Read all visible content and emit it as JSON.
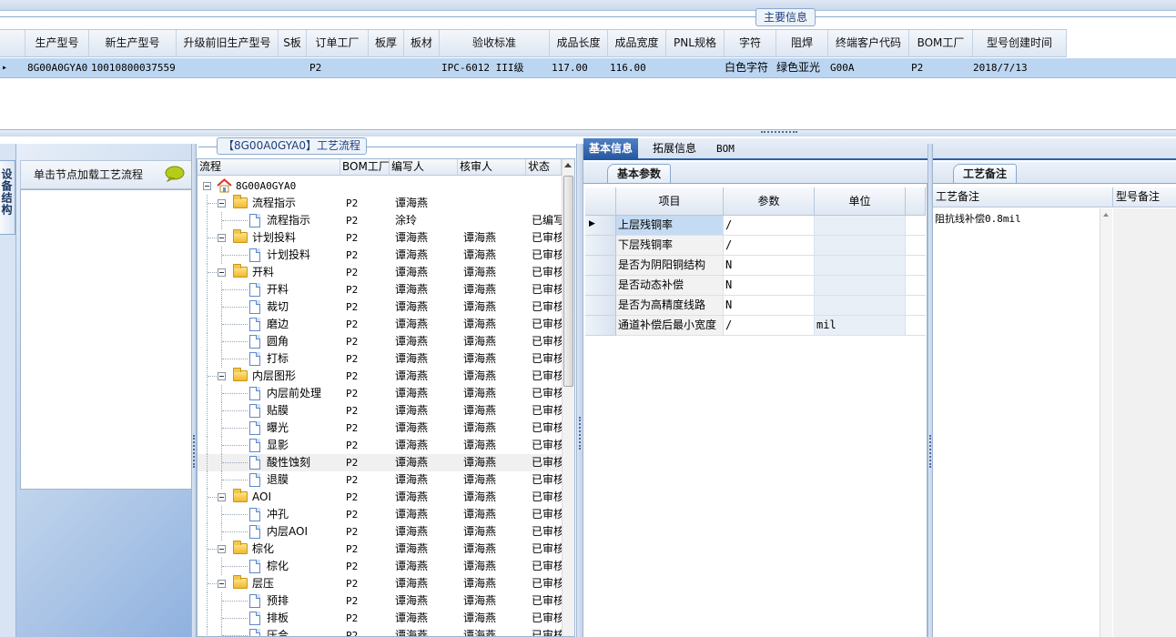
{
  "top": {
    "section_label": "主要信息",
    "columns": [
      "生产型号",
      "新生产型号",
      "升级前旧生产型号",
      "S板",
      "订单工厂",
      "板厚",
      "板材",
      "验收标准",
      "成品长度",
      "成品宽度",
      "PNL规格",
      "字符",
      "阻焊",
      "终端客户代码",
      "BOM工厂",
      "型号创建时间"
    ],
    "row": [
      "8G00A0GYA0",
      "10010800037559",
      "",
      "",
      "P2",
      "",
      "",
      "IPC-6012 III级",
      "117.00",
      "116.00",
      "",
      "白色字符",
      "绿色亚光",
      "G00A",
      "P2",
      "2018/7/13"
    ]
  },
  "left": {
    "vtab_label": "设备结构",
    "header_text": "单击节点加载工艺流程",
    "speech_icon": "speech-bubble-icon"
  },
  "tree": {
    "title": "【8G00A0GYA0】工艺流程",
    "columns": [
      "流程",
      "BOM工厂",
      "编写人",
      "核审人",
      "状态"
    ],
    "root_label": "8G00A0GYA0",
    "rows": [
      {
        "level": 1,
        "type": "folder",
        "label": "流程指示",
        "factory": "P2",
        "writer": "谭海燕",
        "reviewer": "",
        "status": ""
      },
      {
        "level": 2,
        "type": "doc",
        "label": "流程指示",
        "factory": "P2",
        "writer": "涂玲",
        "reviewer": "",
        "status": "已编写"
      },
      {
        "level": 1,
        "type": "folder",
        "label": "计划投料",
        "factory": "P2",
        "writer": "谭海燕",
        "reviewer": "谭海燕",
        "status": "已审核"
      },
      {
        "level": 2,
        "type": "doc",
        "label": "计划投料",
        "factory": "P2",
        "writer": "谭海燕",
        "reviewer": "谭海燕",
        "status": "已审核"
      },
      {
        "level": 1,
        "type": "folder",
        "label": "开料",
        "factory": "P2",
        "writer": "谭海燕",
        "reviewer": "谭海燕",
        "status": "已审核"
      },
      {
        "level": 2,
        "type": "doc",
        "label": "开料",
        "factory": "P2",
        "writer": "谭海燕",
        "reviewer": "谭海燕",
        "status": "已审核"
      },
      {
        "level": 2,
        "type": "doc",
        "label": "裁切",
        "factory": "P2",
        "writer": "谭海燕",
        "reviewer": "谭海燕",
        "status": "已审核"
      },
      {
        "level": 2,
        "type": "doc",
        "label": "磨边",
        "factory": "P2",
        "writer": "谭海燕",
        "reviewer": "谭海燕",
        "status": "已审核"
      },
      {
        "level": 2,
        "type": "doc",
        "label": "圆角",
        "factory": "P2",
        "writer": "谭海燕",
        "reviewer": "谭海燕",
        "status": "已审核"
      },
      {
        "level": 2,
        "type": "doc",
        "label": "打标",
        "factory": "P2",
        "writer": "谭海燕",
        "reviewer": "谭海燕",
        "status": "已审核"
      },
      {
        "level": 1,
        "type": "folder",
        "label": "内层图形",
        "factory": "P2",
        "writer": "谭海燕",
        "reviewer": "谭海燕",
        "status": "已审核"
      },
      {
        "level": 2,
        "type": "doc",
        "label": "内层前处理",
        "factory": "P2",
        "writer": "谭海燕",
        "reviewer": "谭海燕",
        "status": "已审核"
      },
      {
        "level": 2,
        "type": "doc",
        "label": "贴膜",
        "factory": "P2",
        "writer": "谭海燕",
        "reviewer": "谭海燕",
        "status": "已审核"
      },
      {
        "level": 2,
        "type": "doc",
        "label": "曝光",
        "factory": "P2",
        "writer": "谭海燕",
        "reviewer": "谭海燕",
        "status": "已审核"
      },
      {
        "level": 2,
        "type": "doc",
        "label": "显影",
        "factory": "P2",
        "writer": "谭海燕",
        "reviewer": "谭海燕",
        "status": "已审核"
      },
      {
        "level": 2,
        "type": "doc",
        "label": "酸性蚀刻",
        "factory": "P2",
        "writer": "谭海燕",
        "reviewer": "谭海燕",
        "status": "已审核",
        "selected": true
      },
      {
        "level": 2,
        "type": "doc",
        "label": "退膜",
        "factory": "P2",
        "writer": "谭海燕",
        "reviewer": "谭海燕",
        "status": "已审核"
      },
      {
        "level": 1,
        "type": "folder",
        "label": "AOI",
        "factory": "P2",
        "writer": "谭海燕",
        "reviewer": "谭海燕",
        "status": "已审核"
      },
      {
        "level": 2,
        "type": "doc",
        "label": "冲孔",
        "factory": "P2",
        "writer": "谭海燕",
        "reviewer": "谭海燕",
        "status": "已审核"
      },
      {
        "level": 2,
        "type": "doc",
        "label": "内层AOI",
        "factory": "P2",
        "writer": "谭海燕",
        "reviewer": "谭海燕",
        "status": "已审核"
      },
      {
        "level": 1,
        "type": "folder",
        "label": "棕化",
        "factory": "P2",
        "writer": "谭海燕",
        "reviewer": "谭海燕",
        "status": "已审核"
      },
      {
        "level": 2,
        "type": "doc",
        "label": "棕化",
        "factory": "P2",
        "writer": "谭海燕",
        "reviewer": "谭海燕",
        "status": "已审核"
      },
      {
        "level": 1,
        "type": "folder",
        "label": "层压",
        "factory": "P2",
        "writer": "谭海燕",
        "reviewer": "谭海燕",
        "status": "已审核"
      },
      {
        "level": 2,
        "type": "doc",
        "label": "预排",
        "factory": "P2",
        "writer": "谭海燕",
        "reviewer": "谭海燕",
        "status": "已审核"
      },
      {
        "level": 2,
        "type": "doc",
        "label": "排板",
        "factory": "P2",
        "writer": "谭海燕",
        "reviewer": "谭海燕",
        "status": "已审核"
      },
      {
        "level": 2,
        "type": "doc",
        "label": "压合",
        "factory": "P2",
        "writer": "谭海燕",
        "reviewer": "谭海燕",
        "status": "已审核"
      }
    ]
  },
  "right": {
    "tabs": [
      "基本信息",
      "拓展信息",
      "BOM"
    ],
    "basic_params": {
      "tab_label": "基本参数",
      "columns": [
        "项目",
        "参数",
        "单位"
      ],
      "rows": [
        {
          "name": "上层残铜率",
          "value": "/",
          "unit": ""
        },
        {
          "name": "下层残铜率",
          "value": "/",
          "unit": ""
        },
        {
          "name": "是否为阴阳铜结构",
          "value": "N",
          "unit": ""
        },
        {
          "name": "是否动态补偿",
          "value": "N",
          "unit": ""
        },
        {
          "name": "是否为高精度线路",
          "value": "N",
          "unit": ""
        },
        {
          "name": "通道补偿后最小宽度",
          "value": "/",
          "unit": "mil"
        }
      ]
    },
    "craft_notes": {
      "tab_label": "工艺备注",
      "columns": [
        "工艺备注",
        "型号备注"
      ],
      "text": "阻抗线补偿0.8mil"
    }
  }
}
